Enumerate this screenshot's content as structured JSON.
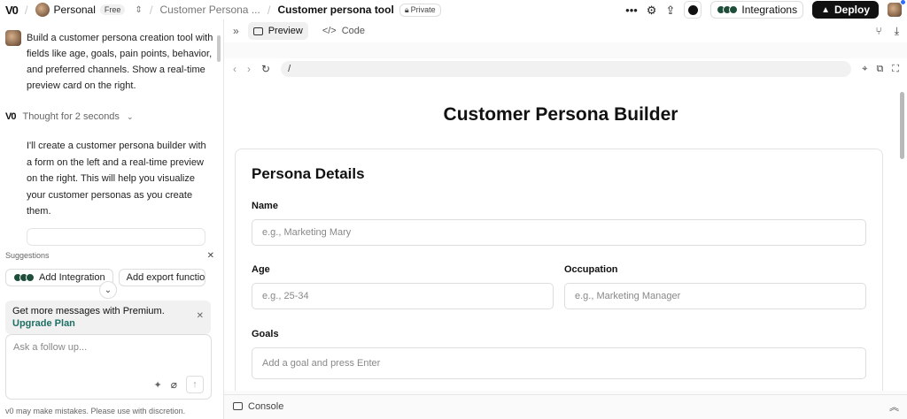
{
  "topbar": {
    "logo": "V0",
    "workspace": "Personal",
    "plan_badge": "Free",
    "project_crumb": "Customer Persona ...",
    "chat_title": "Customer persona tool",
    "visibility": "Private",
    "integrations_label": "Integrations",
    "deploy_label": "Deploy"
  },
  "chat": {
    "user_message": "Build a customer persona creation tool with fields like age, goals, pain points, behavior, and preferred channels. Show a real-time preview card on the right.",
    "thought_label": "Thought for 2 seconds",
    "assistant_message": "I'll create a customer persona builder with a form on the left and a real-time preview on the right. This will help you visualize your customer personas as you create them."
  },
  "suggestions": {
    "title": "Suggestions",
    "chips": [
      {
        "label": "Add Integration"
      },
      {
        "label": "Add export functio"
      }
    ]
  },
  "premium": {
    "text": "Get more messages with Premium.",
    "link": "Upgrade Plan"
  },
  "composer": {
    "placeholder": "Ask a follow up...",
    "value": ""
  },
  "disclaimer": "v0 may make mistakes. Please use with discretion.",
  "preview_panel": {
    "tabs": [
      {
        "label": "Preview",
        "active": true
      },
      {
        "label": "Code",
        "active": false
      }
    ],
    "url": "/",
    "console_label": "Console"
  },
  "app": {
    "title": "Customer Persona Builder",
    "section_title": "Persona Details",
    "fields": {
      "name": {
        "label": "Name",
        "placeholder": "e.g., Marketing Mary"
      },
      "age": {
        "label": "Age",
        "placeholder": "e.g., 25-34"
      },
      "occupation": {
        "label": "Occupation",
        "placeholder": "e.g., Marketing Manager"
      },
      "goals": {
        "label": "Goals",
        "placeholder": "Add a goal and press Enter"
      }
    }
  },
  "colors": {
    "accent_link": "#1e6f64",
    "deploy_bg": "#111111",
    "notification_dot": "#2f6bff"
  }
}
